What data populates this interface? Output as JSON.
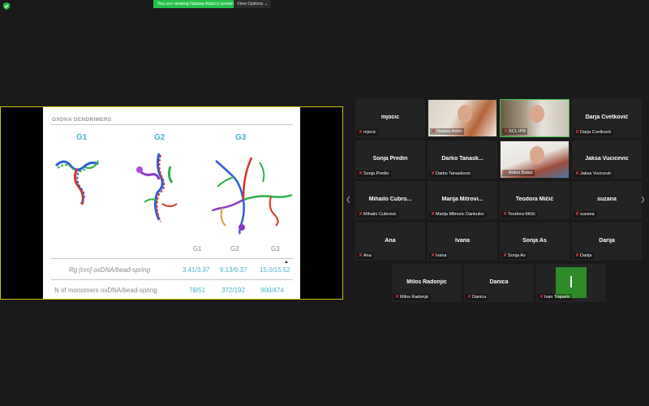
{
  "banner": {
    "text": "You are viewing Natasa Adzic's screen"
  },
  "view_options": {
    "label": "View Options ⌄"
  },
  "slide": {
    "title": "OXDNA DENDRIMERS",
    "generations": [
      "G1",
      "G2",
      "G3"
    ],
    "table": {
      "headers": [
        "G1",
        "G2",
        "G3"
      ],
      "rows": [
        {
          "label": "Rg [nm] oxDNA/bead-spring",
          "values": [
            "3.41/3.37",
            "9.13/9.37",
            "15.0/15.52"
          ]
        },
        {
          "label": "N of monomers oxDNA/bead-spring",
          "values": [
            "78/51",
            "372/192",
            "900/474"
          ]
        }
      ]
    }
  },
  "participants": [
    {
      "name": "mjocic",
      "label": "mjocic",
      "video": false
    },
    {
      "name": "",
      "label": "Natasa Adzic",
      "video": true
    },
    {
      "name": "",
      "label": "SCL IPB",
      "video": true,
      "active": true
    },
    {
      "name": "Darja Cvetković",
      "label": "Darja Cvetković",
      "video": false
    },
    {
      "name": "Sonja Predin",
      "label": "Sonja Predin",
      "video": false
    },
    {
      "name": "Darko Tanask...",
      "label": "Darko Tanaskovic",
      "video": false
    },
    {
      "name": "",
      "label": "Antun Balaz",
      "video": true
    },
    {
      "name": "Jaksa Vucicevic",
      "label": "Jaksa Vucicevic",
      "video": false
    },
    {
      "name": "Mihailo Cubro...",
      "label": "Mihailo Cubrovic",
      "video": false
    },
    {
      "name": "Marija Mitrovi...",
      "label": "Marija Mitrovic Dankulov",
      "video": false
    },
    {
      "name": "Teodora Mičić",
      "label": "Teodora Mičić",
      "video": false
    },
    {
      "name": "suzana",
      "label": "suzana",
      "video": false
    },
    {
      "name": "Ana",
      "label": "Ana",
      "video": false
    },
    {
      "name": "Ivana",
      "label": "Ivana",
      "video": false
    },
    {
      "name": "Sonja As",
      "label": "Sonja As",
      "video": false
    },
    {
      "name": "Darija",
      "label": "Darija",
      "video": false
    },
    {
      "name": "Milos Radonjic",
      "label": "Milos Radonjic",
      "video": false
    },
    {
      "name": "Danica",
      "label": "Danica",
      "video": false
    },
    {
      "name": "",
      "label": "Ivan Traparic",
      "video": false,
      "initial": "I"
    }
  ],
  "colors": {
    "accent_green": "#26c04a",
    "share_border": "#c8c200",
    "slide_teal": "#45b3c9",
    "mute_red": "#e03434"
  }
}
